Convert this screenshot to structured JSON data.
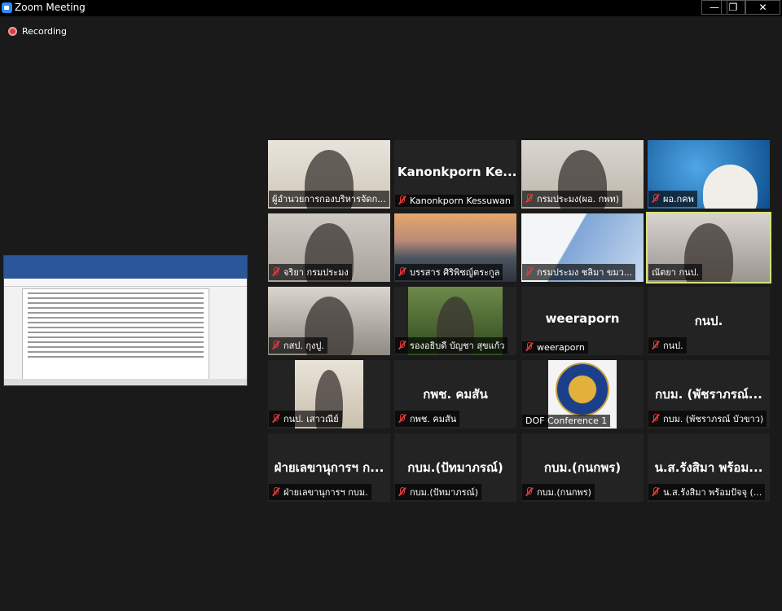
{
  "window": {
    "title": "Zoom Meeting",
    "controls": [
      "—",
      "❐",
      "✕"
    ]
  },
  "recording": {
    "label": "Recording"
  },
  "tiles": [
    {
      "name": "ผู้อำนวยการกองบริหารจัดก...",
      "big": "",
      "video": "man-office",
      "muted": false
    },
    {
      "name": "Kanonkporn Kessuwan",
      "big": "Kanonkporn Ke...",
      "video": "",
      "muted": true
    },
    {
      "name": "กรมประมง(ผอ. กพท)",
      "big": "",
      "video": "man-desk",
      "muted": true
    },
    {
      "name": "ผอ.กคพ",
      "big": "",
      "video": "ocean",
      "muted": true
    },
    {
      "name": "จริยา กรมประมง",
      "big": "",
      "video": "woman-mask",
      "muted": true
    },
    {
      "name": "บรรสาร ศิริพิชญ์ตระกูล",
      "big": "",
      "video": "mountain",
      "muted": true
    },
    {
      "name": "กรมประมง ชลิมา ขมว...",
      "big": "",
      "video": "building",
      "muted": true
    },
    {
      "name": "ณัตยา กนป.",
      "big": "",
      "video": "woman-room",
      "muted": false,
      "active": true
    },
    {
      "name": "กสป. กุงปู.",
      "big": "",
      "video": "printer",
      "muted": true
    },
    {
      "name": "รองอธิบดี บัญชา สุขแก้ว",
      "big": "",
      "video": "man-suit",
      "muted": true
    },
    {
      "name": "weeraporn",
      "big": "weeraporn",
      "video": "",
      "muted": true
    },
    {
      "name": "กนป.",
      "big": "กนป.",
      "video": "",
      "muted": true
    },
    {
      "name": "กนป. เสาวณีย์",
      "big": "",
      "video": "woman-glasses",
      "muted": true
    },
    {
      "name": "กพช. คมสัน",
      "big": "กพช. คมสัน",
      "video": "",
      "muted": true
    },
    {
      "name": "DOF Conference 1",
      "big": "",
      "video": "seal",
      "muted": false
    },
    {
      "name": "กบม. (พัชราภรณ์ บัวขาว)",
      "big": "กบม. (พัชราภรณ์...",
      "video": "",
      "muted": true
    },
    {
      "name": "ฝ่ายเลขานุการฯ กบม.",
      "big": "ฝ่ายเลขานุการฯ ก...",
      "video": "",
      "muted": true
    },
    {
      "name": "กบม.(ปัทมาภรณ์)",
      "big": "กบม.(ปัทมาภรณ์)",
      "video": "",
      "muted": true
    },
    {
      "name": "กบม.(กนกพร)",
      "big": "กบม.(กนกพร)",
      "video": "",
      "muted": true
    },
    {
      "name": "น.ส.รังสิมา พร้อมปัจจุ (...",
      "big": "น.ส.รังสิมา พร้อม...",
      "video": "",
      "muted": true
    }
  ]
}
